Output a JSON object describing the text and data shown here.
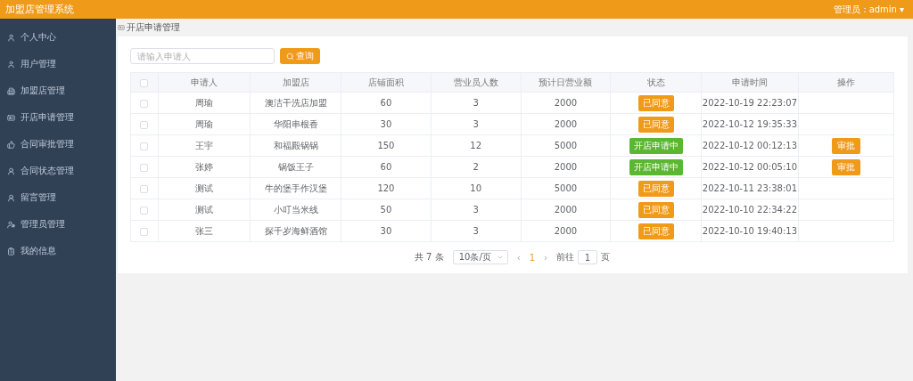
{
  "header": {
    "title": "加盟店管理系统",
    "user": "管理员：admin",
    "caret": "▾"
  },
  "sidebar": {
    "items": [
      {
        "label": "个人中心",
        "selected": false
      },
      {
        "label": "用户管理",
        "selected": false
      },
      {
        "label": "加盟店管理",
        "selected": false
      },
      {
        "label": "开店申请管理",
        "selected": false
      },
      {
        "label": "合同审批管理",
        "selected": false
      },
      {
        "label": "合同状态管理",
        "selected": false
      },
      {
        "label": "留言管理",
        "selected": false
      },
      {
        "label": "管理员管理",
        "selected": false
      },
      {
        "label": "我的信息",
        "selected": false
      }
    ]
  },
  "breadcrumb": "开店申请管理",
  "search": {
    "placeholder": "请输入申请人",
    "button": "查询"
  },
  "table": {
    "header_checked": false,
    "columns": [
      "申请人",
      "加盟店",
      "店铺面积",
      "营业员人数",
      "预计日营业额",
      "状态",
      "申请时间",
      "操作"
    ],
    "rows": [
      {
        "checked": false,
        "cells": [
          "周瑜",
          "澳洁干洗店加盟",
          "60",
          "3",
          "2000"
        ],
        "status": {
          "kind": "approved",
          "label": "已同意"
        },
        "time": "2022-10-19 22:23:07"
      },
      {
        "checked": false,
        "cells": [
          "周瑜",
          "华阳串根香",
          "30",
          "3",
          "2000"
        ],
        "status": {
          "kind": "approved",
          "label": "已同意"
        },
        "time": "2022-10-12 19:35:33"
      },
      {
        "checked": false,
        "cells": [
          "王宇",
          "和福殿锅锅",
          "150",
          "12",
          "5000"
        ],
        "status": {
          "kind": "pending",
          "label": "开店申请中"
        },
        "time": "2022-10-12 00:12:13",
        "action": "审批"
      },
      {
        "checked": false,
        "cells": [
          "张婷",
          "锅饭王子",
          "60",
          "2",
          "2000"
        ],
        "status": {
          "kind": "pending",
          "label": "开店申请中"
        },
        "time": "2022-10-12 00:05:10",
        "action": "审批"
      },
      {
        "checked": false,
        "cells": [
          "测试",
          "牛的堡手作汉堡",
          "120",
          "10",
          "5000"
        ],
        "status": {
          "kind": "approved",
          "label": "已同意"
        },
        "time": "2022-10-11 23:38:01"
      },
      {
        "checked": false,
        "cells": [
          "测试",
          "小叮当米线",
          "50",
          "3",
          "2000"
        ],
        "status": {
          "kind": "approved",
          "label": "已同意"
        },
        "time": "2022-10-10 22:34:22"
      },
      {
        "checked": false,
        "cells": [
          "张三",
          "探千岁海鲜酒馆",
          "30",
          "3",
          "2000"
        ],
        "status": {
          "kind": "approved",
          "label": "已同意"
        },
        "time": "2022-10-10 19:40:13"
      }
    ]
  },
  "pagination": {
    "total": "共 7 条",
    "page_size": "10条/页",
    "pages": [
      {
        "label": "1",
        "selected": true
      }
    ],
    "prev": "‹",
    "next": "›",
    "goto_label": "前往",
    "goto_value": "1",
    "goto_suffix": "页"
  }
}
